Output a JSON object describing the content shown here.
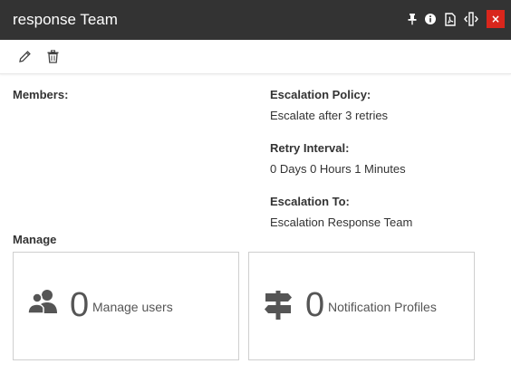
{
  "window": {
    "title": "response Team",
    "close_label": "×",
    "icons": [
      "pin-icon",
      "info-icon",
      "pdf-icon",
      "resize-icon",
      "close-icon"
    ]
  },
  "toolbar": {
    "icons": [
      "edit-icon",
      "delete-icon"
    ]
  },
  "details": {
    "members_label": "Members:",
    "escalation_policy_label": "Escalation Policy:",
    "escalation_policy_value": "Escalate after 3 retries",
    "retry_interval_label": "Retry Interval:",
    "retry_interval_value": "0 Days 0 Hours 1 Minutes",
    "escalation_to_label": "Escalation To:",
    "escalation_to_value": "Escalation Response Team"
  },
  "manage": {
    "heading": "Manage",
    "cards": [
      {
        "icon": "users-icon",
        "count": "0",
        "label": "Manage users"
      },
      {
        "icon": "signpost-icon",
        "count": "0",
        "label": "Notification Profiles"
      }
    ]
  },
  "colors": {
    "titlebar": "#333333",
    "close": "#d9261c",
    "card_border": "#cfcfcf"
  }
}
